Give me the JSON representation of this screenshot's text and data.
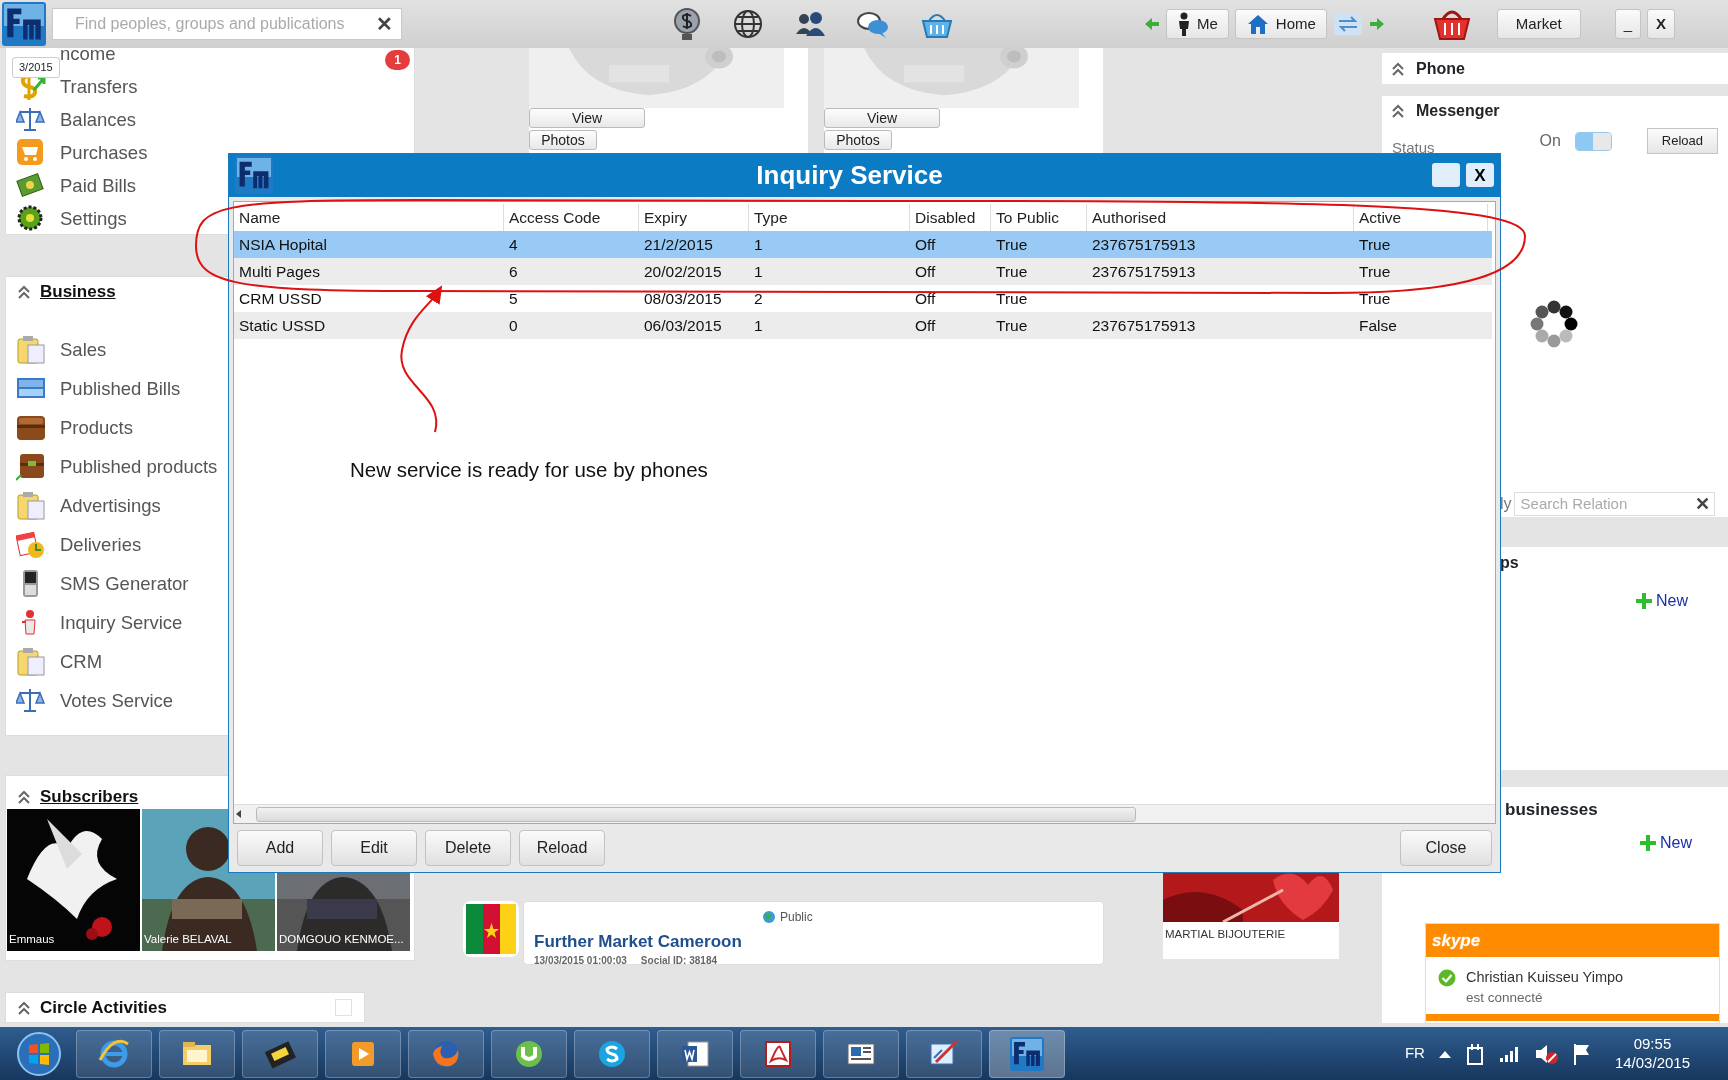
{
  "topbar": {
    "search": {
      "placeholder": "Find peoples, groups and publications"
    },
    "clear": "✕",
    "me": "Me",
    "home": "Home",
    "market": "Market",
    "minimize": "_",
    "close": "X"
  },
  "left": {
    "date_badge": "3/2015",
    "notification_badge": "1",
    "account_items": [
      {
        "label": "ncome"
      },
      {
        "label": "Transfers"
      },
      {
        "label": "Balances"
      },
      {
        "label": "Purchases"
      },
      {
        "label": "Paid Bills"
      },
      {
        "label": "Settings"
      }
    ],
    "business": {
      "title": "Business",
      "items": [
        {
          "label": "Sales"
        },
        {
          "label": "Published Bills"
        },
        {
          "label": "Products"
        },
        {
          "label": "Published products"
        },
        {
          "label": "Advertisings"
        },
        {
          "label": "Deliveries"
        },
        {
          "label": "SMS Generator"
        },
        {
          "label": "Inquiry Service"
        },
        {
          "label": "CRM"
        },
        {
          "label": "Votes Service"
        }
      ]
    },
    "subscribers": {
      "title": "Subscribers",
      "items": [
        {
          "name": "Emmaus"
        },
        {
          "name": "Valerie BELAVAL"
        },
        {
          "name": "DOMGOUO KENMOE..."
        }
      ]
    },
    "circle": {
      "title": "Circle Activities",
      "checked": false
    }
  },
  "center": {
    "products": [
      {
        "view": "View",
        "photos": "Photos"
      },
      {
        "view": "View",
        "photos": "Photos"
      }
    ],
    "post": {
      "visibility": "Public",
      "title": "Further Market Cameroon",
      "date": "13/03/2015 01:00:03",
      "social_id": "Social ID: 38184"
    },
    "shop": {
      "name": "MARTIAL BIJOUTERIE"
    }
  },
  "right": {
    "phone": {
      "title": "Phone"
    },
    "messenger": {
      "title": "Messenger",
      "status": "Status",
      "on_label": "On",
      "on": true,
      "reload": "Reload"
    },
    "search": {
      "prefix": "ly",
      "placeholder": "Search Relation",
      "clear": "✕"
    },
    "groups": {
      "title": "ps",
      "new": "New"
    },
    "businesses": {
      "title": "businesses",
      "new": "New"
    }
  },
  "dialog": {
    "title": "Inquiry Service",
    "close_x": "X",
    "columns": [
      "Name",
      "Access Code",
      "Expiry",
      "Type",
      "Disabled",
      "To Public",
      "Authorised",
      "Active"
    ],
    "rows": [
      {
        "selected": true,
        "cells": [
          "NSIA Hopital",
          "4",
          "21/2/2015",
          "1",
          "Off",
          "True",
          "237675175913",
          "True"
        ]
      },
      {
        "selected": false,
        "cells": [
          "Multi Pages",
          "6",
          "20/02/2015",
          "1",
          "Off",
          "True",
          "237675175913",
          "True"
        ]
      },
      {
        "selected": false,
        "cells": [
          "CRM USSD",
          "5",
          "08/03/2015",
          "2",
          "Off",
          "True",
          null,
          "True"
        ]
      },
      {
        "selected": false,
        "cells": [
          "Static USSD",
          "0",
          "06/03/2015",
          "1",
          "Off",
          "True",
          "237675175913",
          "False"
        ]
      }
    ],
    "buttons": [
      "Add",
      "Edit",
      "Delete",
      "Reload"
    ],
    "close": "Close"
  },
  "annotation": {
    "text": "New service is ready for use by phones"
  },
  "skype": {
    "brand": "skype",
    "name": "Christian Kuisseu Yimpo",
    "status": "est connecté"
  },
  "taskbar": {
    "language": "FR",
    "time": "09:55",
    "date": "14/03/2015"
  }
}
